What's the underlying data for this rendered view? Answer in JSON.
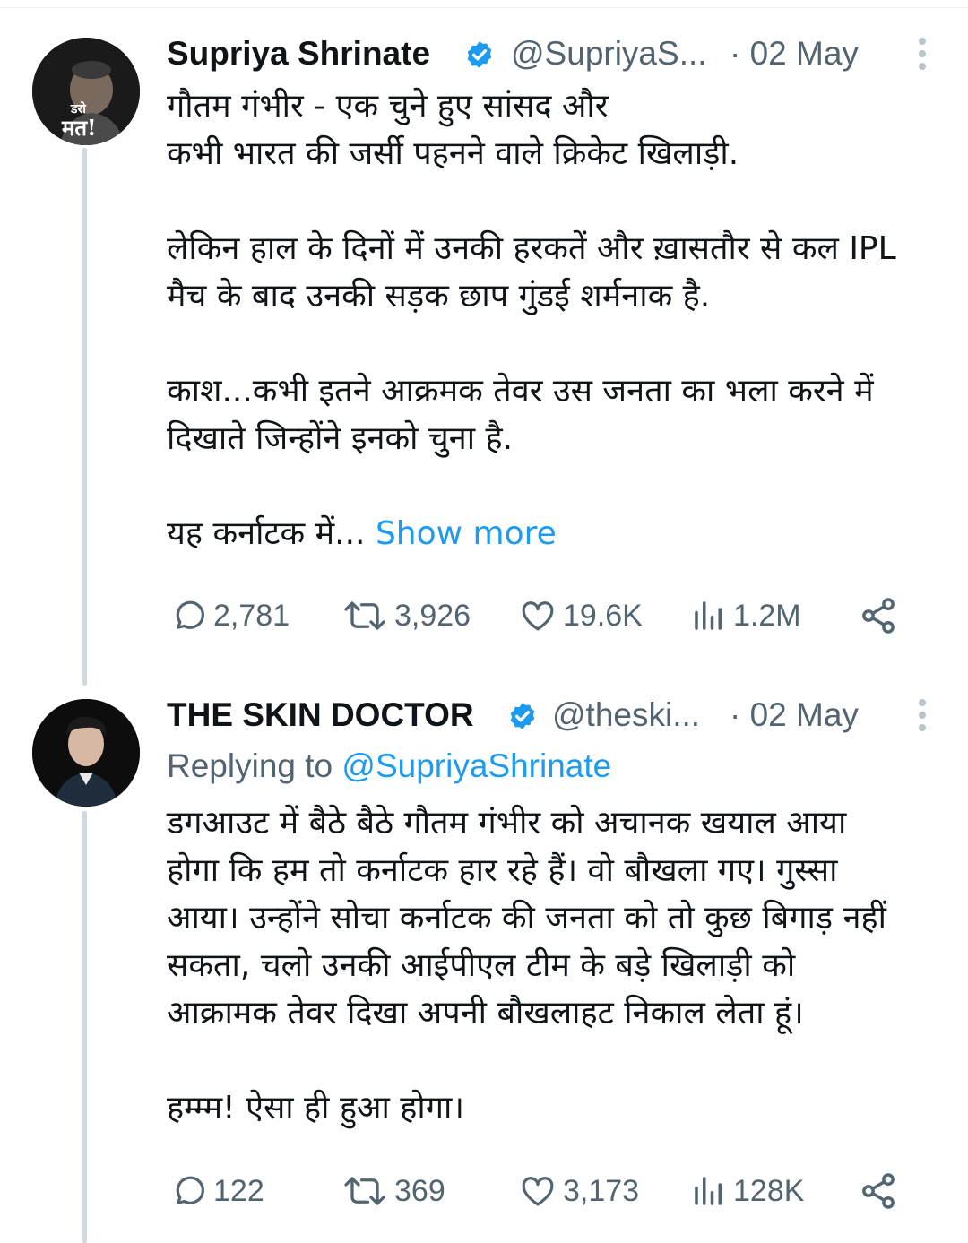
{
  "tweets": [
    {
      "name": "Supriya Shrinate",
      "handle": "@SupriyaS...",
      "date": "· 02 May",
      "avatar_text_small": "डरो",
      "avatar_text_big": "मत!",
      "body": "गौतम गंभीर - एक चुने हुए सांसद और\nकभी भारत की जर्सी पहनने वाले क्रिकेट खिलाड़ी.\n\nलेकिन हाल के दिनों में उनकी हरकतें और ख़ासतौर से कल IPL\nमैच के बाद उनकी सड़क छाप गुंडई शर्मनाक है.\n\nकाश...कभी इतने आक्रमक तेवर उस जनता का भला करने में\nदिखाते जिन्होंने इनको चुना है.\n\nयह कर्नाटक में...",
      "show_more": "Show more",
      "replies": "2,781",
      "retweets": "3,926",
      "likes": "19.6K",
      "views": "1.2M"
    },
    {
      "name": "THE SKIN DOCTOR",
      "handle": "@theski...",
      "date": "· 02 May",
      "replying_label": "Replying to",
      "replying_to": "@SupriyaShrinate",
      "body": "डगआउट में बैठे बैठे गौतम गंभीर को अचानक खयाल आया\nहोगा कि हम तो कर्नाटक हार रहे हैं। वो बौखला गए। गुस्सा\nआया। उन्होंने सोचा कर्नाटक की जनता को तो कुछ बिगाड़ नहीं\nसकता, चलो उनकी आईपीएल टीम के बड़े खिलाड़ी को\nआक्रामक तेवर दिखा अपनी बौखलाहट निकाल लेता हूं।\n\nहम्म्म! ऐसा ही हुआ होगा।",
      "replies": "122",
      "retweets": "369",
      "likes": "3,173",
      "views": "128K"
    }
  ],
  "colors": {
    "accent": "#1d9bf0",
    "muted": "#536471",
    "thread": "#cfd9de"
  },
  "icons": [
    "verified-badge-icon",
    "more-options-icon",
    "reply-icon",
    "retweet-icon",
    "like-icon",
    "views-icon",
    "share-icon"
  ]
}
